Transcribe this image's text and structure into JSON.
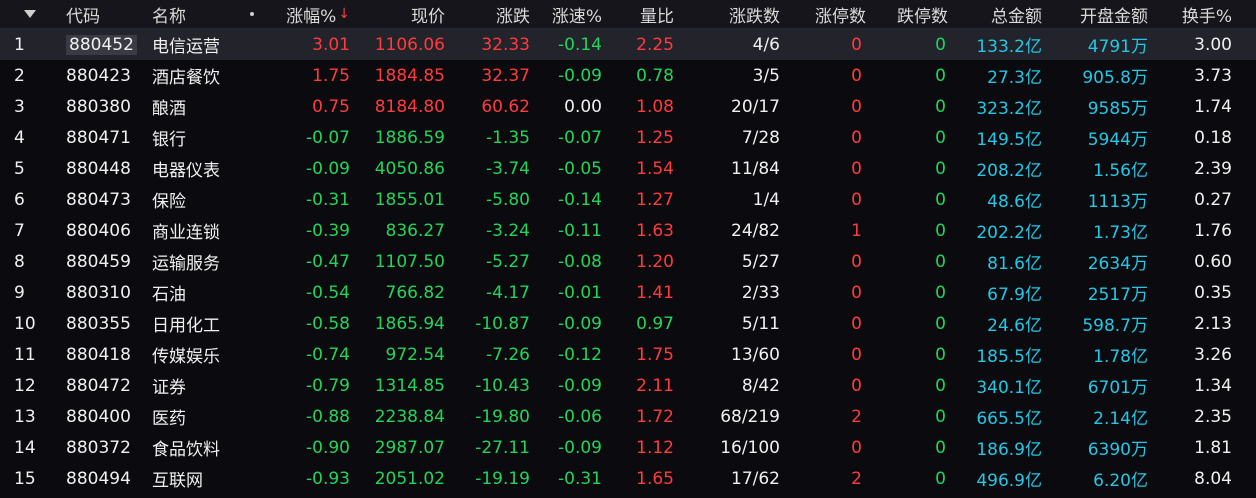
{
  "header": {
    "index_icon": "caret-down-icon",
    "code": "代码",
    "name": "名称",
    "sort_icon": "dot-icon",
    "pct": "涨幅%",
    "pct_arrow": "↓",
    "price": "现价",
    "chg": "涨跌",
    "speed": "涨速%",
    "vol_ratio": "量比",
    "updown": "涨跌数",
    "limitup": "涨停数",
    "limitdown": "跌停数",
    "amount": "总金额",
    "open_amount": "开盘金额",
    "turnover": "换手%"
  },
  "colors": {
    "red": "#ff3b3b",
    "green": "#1fd65a",
    "cyan": "#22c8e6",
    "white": "#f0f0f0"
  },
  "rows": [
    {
      "idx": "1",
      "code": "880452",
      "name": "电信运营",
      "pct": "3.01",
      "price": "1106.06",
      "chg": "32.33",
      "speed": "-0.14",
      "vr": "2.25",
      "ud": "4/6",
      "lu": "0",
      "ld": "0",
      "amt": "133.2亿",
      "oamt": "4791万",
      "to": "3.00"
    },
    {
      "idx": "2",
      "code": "880423",
      "name": "酒店餐饮",
      "pct": "1.75",
      "price": "1884.85",
      "chg": "32.37",
      "speed": "-0.09",
      "vr": "0.78",
      "ud": "3/5",
      "lu": "0",
      "ld": "0",
      "amt": "27.3亿",
      "oamt": "905.8万",
      "to": "3.73"
    },
    {
      "idx": "3",
      "code": "880380",
      "name": "酿酒",
      "pct": "0.75",
      "price": "8184.80",
      "chg": "60.62",
      "speed": "0.00",
      "vr": "1.08",
      "ud": "20/17",
      "lu": "0",
      "ld": "0",
      "amt": "323.2亿",
      "oamt": "9585万",
      "to": "1.74"
    },
    {
      "idx": "4",
      "code": "880471",
      "name": "银行",
      "pct": "-0.07",
      "price": "1886.59",
      "chg": "-1.35",
      "speed": "-0.07",
      "vr": "1.25",
      "ud": "7/28",
      "lu": "0",
      "ld": "0",
      "amt": "149.5亿",
      "oamt": "5944万",
      "to": "0.18"
    },
    {
      "idx": "5",
      "code": "880448",
      "name": "电器仪表",
      "pct": "-0.09",
      "price": "4050.86",
      "chg": "-3.74",
      "speed": "-0.05",
      "vr": "1.54",
      "ud": "11/84",
      "lu": "0",
      "ld": "0",
      "amt": "208.2亿",
      "oamt": "1.56亿",
      "to": "2.39"
    },
    {
      "idx": "6",
      "code": "880473",
      "name": "保险",
      "pct": "-0.31",
      "price": "1855.01",
      "chg": "-5.80",
      "speed": "-0.14",
      "vr": "1.27",
      "ud": "1/4",
      "lu": "0",
      "ld": "0",
      "amt": "48.6亿",
      "oamt": "1113万",
      "to": "0.27"
    },
    {
      "idx": "7",
      "code": "880406",
      "name": "商业连锁",
      "pct": "-0.39",
      "price": "836.27",
      "chg": "-3.24",
      "speed": "-0.11",
      "vr": "1.63",
      "ud": "24/82",
      "lu": "1",
      "ld": "0",
      "amt": "202.2亿",
      "oamt": "1.73亿",
      "to": "1.76"
    },
    {
      "idx": "8",
      "code": "880459",
      "name": "运输服务",
      "pct": "-0.47",
      "price": "1107.50",
      "chg": "-5.27",
      "speed": "-0.08",
      "vr": "1.20",
      "ud": "5/27",
      "lu": "0",
      "ld": "0",
      "amt": "81.6亿",
      "oamt": "2634万",
      "to": "0.60"
    },
    {
      "idx": "9",
      "code": "880310",
      "name": "石油",
      "pct": "-0.54",
      "price": "766.82",
      "chg": "-4.17",
      "speed": "-0.01",
      "vr": "1.41",
      "ud": "2/33",
      "lu": "0",
      "ld": "0",
      "amt": "67.9亿",
      "oamt": "2517万",
      "to": "0.35"
    },
    {
      "idx": "10",
      "code": "880355",
      "name": "日用化工",
      "pct": "-0.58",
      "price": "1865.94",
      "chg": "-10.87",
      "speed": "-0.09",
      "vr": "0.97",
      "ud": "5/11",
      "lu": "0",
      "ld": "0",
      "amt": "24.6亿",
      "oamt": "598.7万",
      "to": "2.13"
    },
    {
      "idx": "11",
      "code": "880418",
      "name": "传媒娱乐",
      "pct": "-0.74",
      "price": "972.54",
      "chg": "-7.26",
      "speed": "-0.12",
      "vr": "1.75",
      "ud": "13/60",
      "lu": "0",
      "ld": "0",
      "amt": "185.5亿",
      "oamt": "1.78亿",
      "to": "3.26"
    },
    {
      "idx": "12",
      "code": "880472",
      "name": "证券",
      "pct": "-0.79",
      "price": "1314.85",
      "chg": "-10.43",
      "speed": "-0.09",
      "vr": "2.11",
      "ud": "8/42",
      "lu": "0",
      "ld": "0",
      "amt": "340.1亿",
      "oamt": "6701万",
      "to": "1.34"
    },
    {
      "idx": "13",
      "code": "880400",
      "name": "医药",
      "pct": "-0.88",
      "price": "2238.84",
      "chg": "-19.80",
      "speed": "-0.06",
      "vr": "1.72",
      "ud": "68/219",
      "lu": "2",
      "ld": "0",
      "amt": "665.5亿",
      "oamt": "2.14亿",
      "to": "2.35"
    },
    {
      "idx": "14",
      "code": "880372",
      "name": "食品饮料",
      "pct": "-0.90",
      "price": "2987.07",
      "chg": "-27.11",
      "speed": "-0.09",
      "vr": "1.12",
      "ud": "16/100",
      "lu": "0",
      "ld": "0",
      "amt": "186.9亿",
      "oamt": "6390万",
      "to": "1.81"
    },
    {
      "idx": "15",
      "code": "880494",
      "name": "互联网",
      "pct": "-0.93",
      "price": "2051.02",
      "chg": "-19.19",
      "speed": "-0.31",
      "vr": "1.65",
      "ud": "17/62",
      "lu": "2",
      "ld": "0",
      "amt": "496.9亿",
      "oamt": "6.20亿",
      "to": "8.04"
    }
  ]
}
